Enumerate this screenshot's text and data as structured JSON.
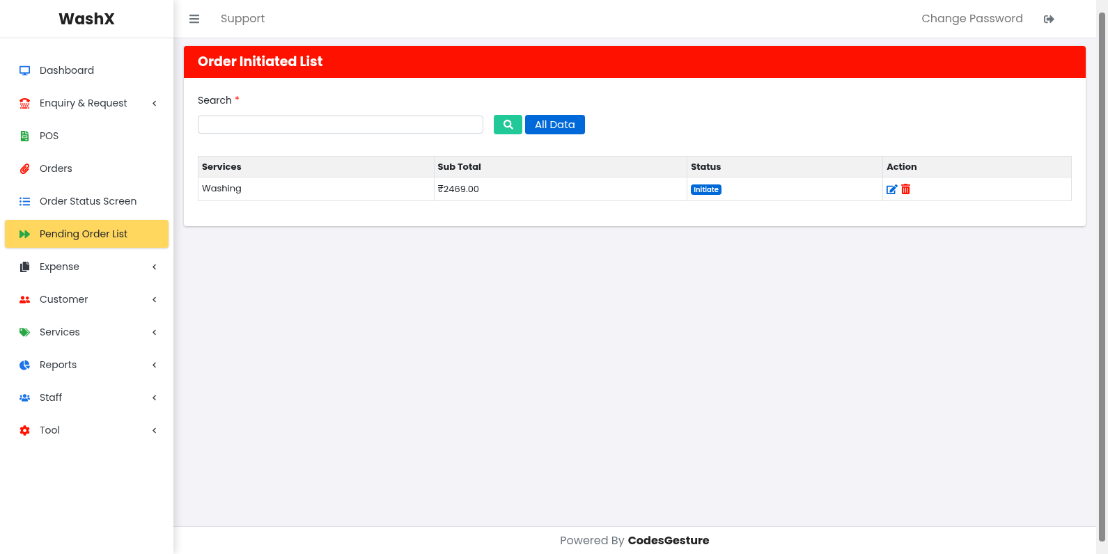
{
  "brand": "WashX",
  "sidebar": {
    "items": [
      {
        "kind": "desktop",
        "label": "Dashboard",
        "color": "#1a73e8",
        "submenu": false,
        "selected": false
      },
      {
        "kind": "phone",
        "label": "Enquiry & Request",
        "color": "#ff1100",
        "submenu": true,
        "selected": false
      },
      {
        "kind": "file",
        "label": "POS",
        "color": "#28a745",
        "submenu": false,
        "selected": false
      },
      {
        "kind": "paperclip",
        "label": "Orders",
        "color": "#ff1100",
        "submenu": false,
        "selected": false
      },
      {
        "kind": "list",
        "label": "Order Status Screen",
        "color": "#1a73e8",
        "submenu": false,
        "selected": false
      },
      {
        "kind": "forward",
        "label": "Pending Order List",
        "color": "#28a745",
        "submenu": false,
        "selected": true
      },
      {
        "kind": "copy",
        "label": "Expense",
        "color": "#343a40",
        "submenu": true,
        "selected": false
      },
      {
        "kind": "pair",
        "label": "Customer",
        "color": "#ff1100",
        "submenu": true,
        "selected": false
      },
      {
        "kind": "tags",
        "label": "Services",
        "color": "#28a745",
        "submenu": true,
        "selected": false
      },
      {
        "kind": "pie",
        "label": "Reports",
        "color": "#1a73e8",
        "submenu": true,
        "selected": false
      },
      {
        "kind": "users",
        "label": "Staff",
        "color": "#1a73e8",
        "submenu": true,
        "selected": false
      },
      {
        "kind": "cog",
        "label": "Tool",
        "color": "#ff1100",
        "submenu": true,
        "selected": false
      }
    ]
  },
  "topbar": {
    "links": [
      "Support"
    ],
    "right_link": "Change Password"
  },
  "card": {
    "title": "Order Initiated List",
    "search": {
      "label": "Search",
      "required_mark": "*"
    },
    "all_data_button": "All Data",
    "table": {
      "columns": [
        "Services",
        "Sub Total",
        "Status",
        "Action"
      ],
      "rows": [
        {
          "services": "Washing",
          "sub_total": "₹2469.00",
          "status": "Initiate"
        }
      ]
    }
  },
  "footer": {
    "prefix": "Powered By",
    "brand": "CodesGesture"
  }
}
